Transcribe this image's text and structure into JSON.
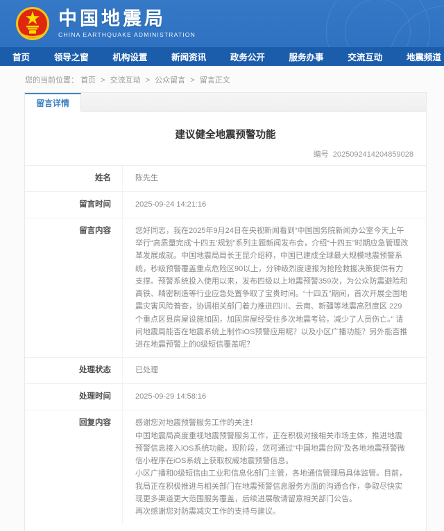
{
  "header": {
    "site_name": "中国地震局",
    "site_name_en": "CHINA EARTHQUAKE ADMINISTRATION"
  },
  "nav": {
    "items": [
      "首页",
      "领导之窗",
      "机构设置",
      "新闻资讯",
      "政务公开",
      "服务办事",
      "交流互动",
      "地震频道"
    ]
  },
  "breadcrumb": {
    "prefix": "您的当前位置：",
    "sep": ">",
    "items": [
      "首页",
      "交流互动",
      "公众留言",
      "留言正文"
    ]
  },
  "panel": {
    "tab_label": "留言详情",
    "title": "建议健全地震预警功能",
    "number_label": "编号",
    "number_value": "2025092414204859028",
    "rows": [
      {
        "label": "姓名",
        "value": "陈先生"
      },
      {
        "label": "留言时间",
        "value": "2025-09-24 14:21:16"
      },
      {
        "label": "留言内容",
        "value": "您好同志，我在2025年9月24日在央视新闻看到“中国国务院新闻办公室今天上午举行“高质量完成‘十四五’规划”系列主题新闻发布会，介绍“十四五”时期应急管理改革发展成就。中国地震局局长王昆介绍称，中国已建成全球最大规模地震预警系统，秒级预警覆盖重点危险区90以上，分钟级烈度速报为抢险救援决策提供有力支撑。预警系统投入使用以来，发布四级以上地震预警359次，为公众防震避险和高铁、精密制造等行业应急处置争取了宝贵时间。“十四五”期间，首次开展全国地震灾害风险普查，协调相关部门着力推进四川、云南、新疆等地震高烈度区 229个重点区县房屋设施加固，加固房屋经受住多次地震考验，减少了人员伤亡。”  请问地震局能否在地震系统上制作iOS预警应用呢？以及小区广播功能？另外能否推进在地震预警上的0级短信覆盖呢？"
      },
      {
        "label": "处理状态",
        "value": "已处理"
      },
      {
        "label": "处理时间",
        "value": "2025-09-29 14:58:16"
      },
      {
        "label": "回复内容",
        "lines": [
          "感谢您对地震预警服务工作的关注！",
          "中国地震局高度重视地震预警服务工作，正在积极对接相关市场主体，推进地震预警信息接入iOS系统功能。现阶段，您可通过“中国地震台网”及各地地震预警微信小程序在iOS系统上获取权威地震预警信息。",
          "小区广播和0级短信由工业和信息化部门主管，各地通信管理局具体监管。目前，我局正在积极推进与相关部门在地震预警信息服务方面的沟通合作，争取尽快实现更多渠道更大范围服务覆盖，后续进展敬请留意相关部门公告。",
          "再次感谢您对防震减灾工作的支持与建议。"
        ]
      }
    ]
  },
  "colors": {
    "header_blue": "#3174c3",
    "nav_blue": "#1b5dab",
    "tab_accent": "#3f86c4",
    "emblem_red": "#de2910",
    "emblem_gold": "#ffde00"
  }
}
